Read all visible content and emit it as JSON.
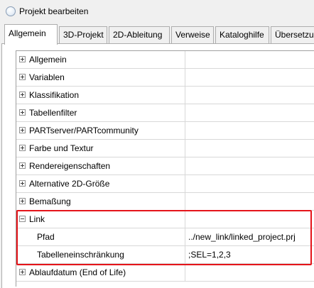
{
  "window": {
    "title": "Projekt bearbeiten",
    "icon": "circle-window-icon"
  },
  "tabs": [
    {
      "label": "Allgemein",
      "active": true
    },
    {
      "label": "3D-Projekt",
      "active": false
    },
    {
      "label": "2D-Ableitung",
      "active": false
    },
    {
      "label": "Verweise",
      "active": false
    },
    {
      "label": "Kataloghilfe",
      "active": false
    },
    {
      "label": "Übersetzun",
      "active": false
    }
  ],
  "properties": {
    "categories": [
      {
        "label": "Allgemein",
        "expanded": false
      },
      {
        "label": "Variablen",
        "expanded": false
      },
      {
        "label": "Klassifikation",
        "expanded": false
      },
      {
        "label": "Tabellenfilter",
        "expanded": false
      },
      {
        "label": "PARTserver/PARTcommunity",
        "expanded": false
      },
      {
        "label": "Farbe und Textur",
        "expanded": false
      },
      {
        "label": "Rendereigenschaften",
        "expanded": false
      },
      {
        "label": "Alternative 2D-Größe",
        "expanded": false
      },
      {
        "label": "Bemaßung",
        "expanded": false
      },
      {
        "label": "Link",
        "expanded": true
      },
      {
        "label": "Ablaufdatum (End of Life)",
        "expanded": false
      }
    ],
    "link_children": [
      {
        "label": "Pfad",
        "value": "../new_link/linked_project.prj"
      },
      {
        "label": "Tabelleneinschränkung",
        "value": ";SEL=1,2,3"
      }
    ]
  },
  "colors": {
    "highlight": "#e5141a",
    "grid_line": "#d8d8d8",
    "background": "#f0f0f0"
  }
}
